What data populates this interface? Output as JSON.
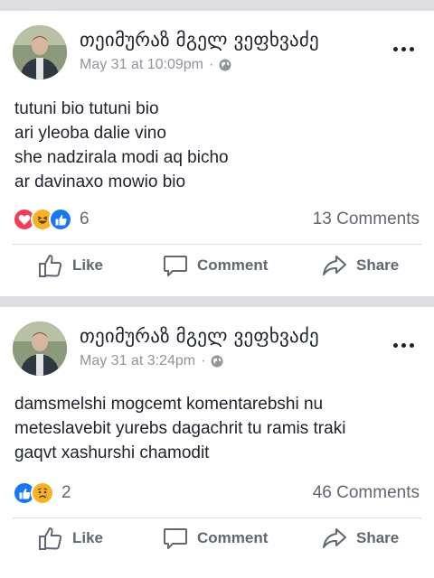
{
  "posts": [
    {
      "author": "თეიმურაზ მგელ ვეფხვაძე",
      "timestamp": "May 31 at 10:09pm",
      "privacy_icon": "globe-icon",
      "lines": [
        "tutuni bio tutuni bio",
        "ari yleoba dalie vino",
        "she nadzirala modi aq bicho",
        "ar davinaxo mowio bio"
      ],
      "reactions": [
        "love",
        "haha",
        "like"
      ],
      "reaction_count": "6",
      "comments": "13 Comments"
    },
    {
      "author": "თეიმურაზ მგელ ვეფხვაძე",
      "timestamp": "May 31 at 3:24pm",
      "privacy_icon": "globe-icon",
      "lines": [
        "damsmelshi mogcemt komentarebshi nu",
        "meteslavebit yurebs dagachrit tu ramis traki",
        "gaqvt xashurshi chamodit"
      ],
      "reactions": [
        "like",
        "sad"
      ],
      "reaction_count": "2",
      "comments": "46 Comments"
    }
  ],
  "actions": {
    "like": "Like",
    "comment": "Comment",
    "share": "Share"
  },
  "colors": {
    "background": "#dddfe2",
    "card": "#ffffff",
    "text": "#1d2129",
    "secondary": "#90949c",
    "like_blue": "#1877f2",
    "love_red": "#f33e58",
    "haha_yellow": "#f7b125"
  }
}
